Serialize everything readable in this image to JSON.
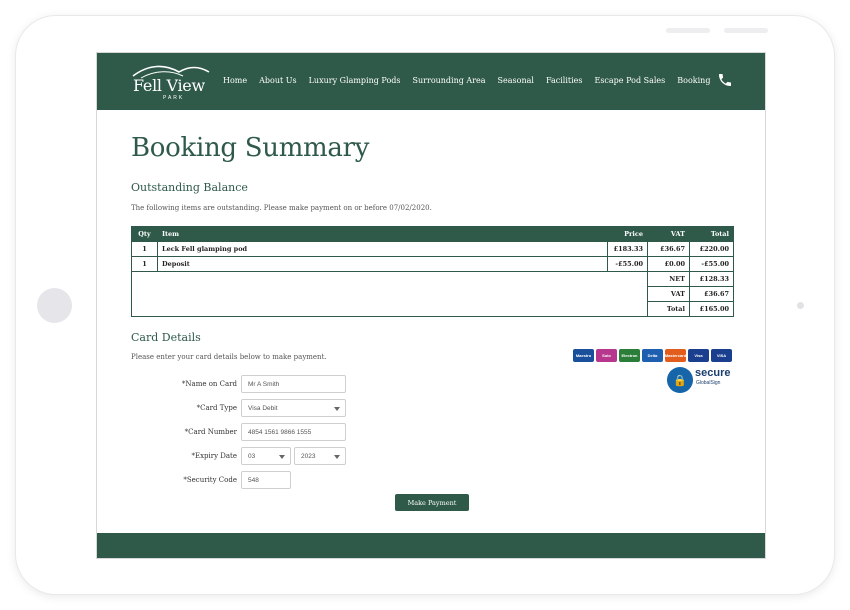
{
  "brand": {
    "logo_main": "Fell View",
    "logo_sub": "PARK",
    "color_primary": "#2f5a4a"
  },
  "nav": {
    "items": [
      "Home",
      "About Us",
      "Luxury Glamping Pods",
      "Surrounding Area",
      "Seasonal",
      "Facilities",
      "Escape Pod Sales",
      "Booking"
    ],
    "phone_icon": "phone-icon"
  },
  "page": {
    "title": "Booking Summary"
  },
  "balance": {
    "heading": "Outstanding Balance",
    "note": "The following items are outstanding. Please make payment on or before 07/02/2020.",
    "columns": {
      "qty": "Qty",
      "item": "Item",
      "price": "Price",
      "vat": "VAT",
      "total": "Total"
    },
    "rows": [
      {
        "qty": "1",
        "item": "Leck Fell glamping pod",
        "price": "£183.33",
        "vat": "£36.67",
        "total": "£220.00"
      },
      {
        "qty": "1",
        "item": "Deposit",
        "price": "-£55.00",
        "vat": "£0.00",
        "total": "-£55.00"
      }
    ],
    "summary": [
      {
        "label": "NET",
        "value": "£128.33"
      },
      {
        "label": "VAT",
        "value": "£36.67"
      },
      {
        "label": "Total",
        "value": "£165.00"
      }
    ]
  },
  "card": {
    "heading": "Card Details",
    "note": "Please enter your card details below to make payment.",
    "logos": [
      "Maestro",
      "Solo",
      "Electron",
      "Delta",
      "Mastercard",
      "Visa",
      "VISA"
    ],
    "secure": {
      "word": "secure",
      "by": "GlobalSign"
    },
    "fields": {
      "name_label": "*Name on Card",
      "name_value": "Mr A Smith",
      "type_label": "*Card Type",
      "type_value": "Visa Debit",
      "number_label": "*Card Number",
      "number_value": "4854 1561 9866 1555",
      "expiry_label": "*Expiry Date",
      "expiry_month": "03",
      "expiry_year": "2023",
      "security_label": "*Security Code",
      "security_value": "548"
    },
    "submit_label": "Make Payment"
  }
}
